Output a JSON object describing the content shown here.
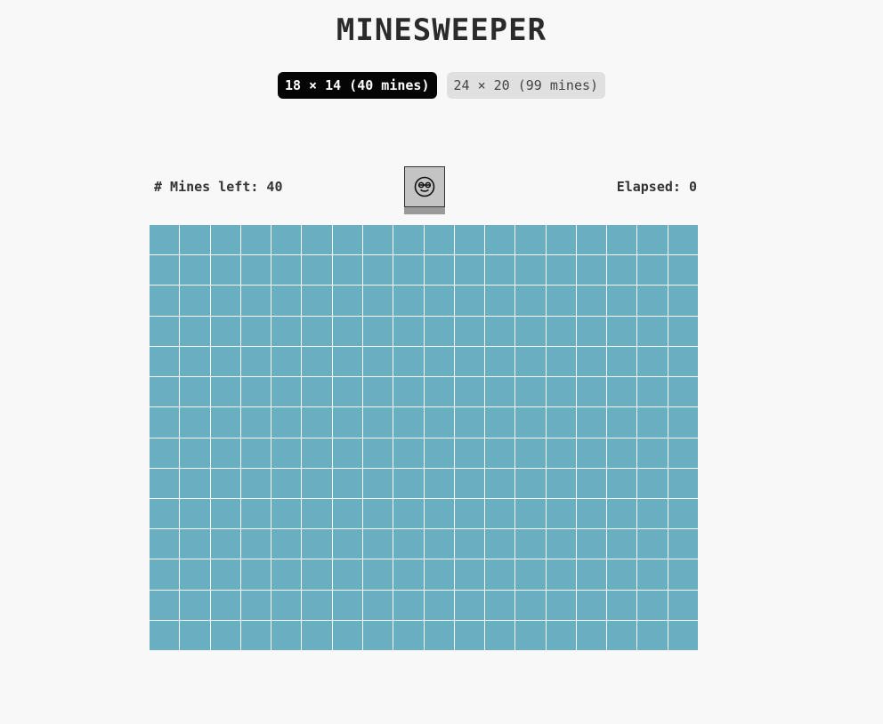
{
  "header": {
    "title": "MINESWEEPER"
  },
  "difficulty": {
    "options": [
      {
        "label": "18 × 14 (40 mines)",
        "active": true
      },
      {
        "label": "24 × 20 (99 mines)",
        "active": false
      }
    ]
  },
  "status": {
    "mines_left": "# Mines left: 40",
    "elapsed": "Elapsed: 0",
    "face_icon": "sunglasses-smiley-face"
  },
  "board": {
    "columns": 18,
    "rows": 14,
    "cell_color": "#6aaec1",
    "state": "all-unrevealed"
  },
  "colors": {
    "background": "#f8f8f8",
    "active_button": "#050505",
    "inactive_button": "#e0e0e0",
    "face_button": "#c4c4c4"
  }
}
